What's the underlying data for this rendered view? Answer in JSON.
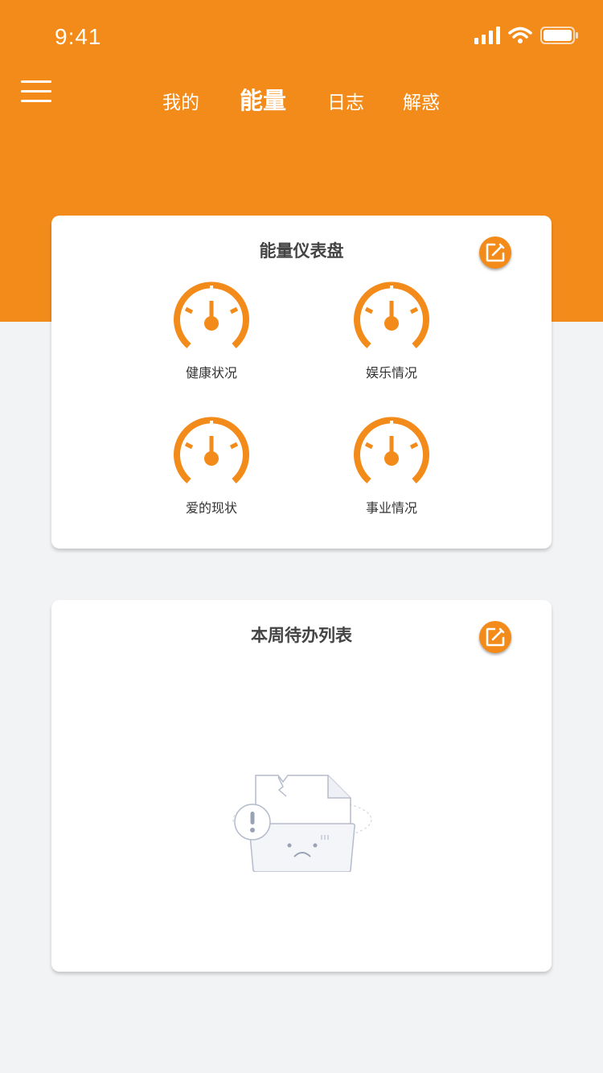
{
  "status_bar": {
    "time": "9:41"
  },
  "nav": {
    "tabs": [
      {
        "label": "我的",
        "active": false
      },
      {
        "label": "能量",
        "active": true
      },
      {
        "label": "日志",
        "active": false
      },
      {
        "label": "解惑",
        "active": false
      }
    ]
  },
  "dashboard": {
    "title": "能量仪表盘",
    "gauges": [
      {
        "label": "健康状况"
      },
      {
        "label": "娱乐情况"
      },
      {
        "label": "爱的现状"
      },
      {
        "label": "事业情况"
      }
    ]
  },
  "todo": {
    "title": "本周待办列表"
  },
  "colors": {
    "accent": "#f38b1a",
    "background": "#f2f3f5",
    "card": "#ffffff"
  },
  "icons": [
    "menu-icon",
    "signal-icon",
    "wifi-icon",
    "battery-icon",
    "edit-icon",
    "gauge-icon",
    "empty-folder-illustration"
  ]
}
